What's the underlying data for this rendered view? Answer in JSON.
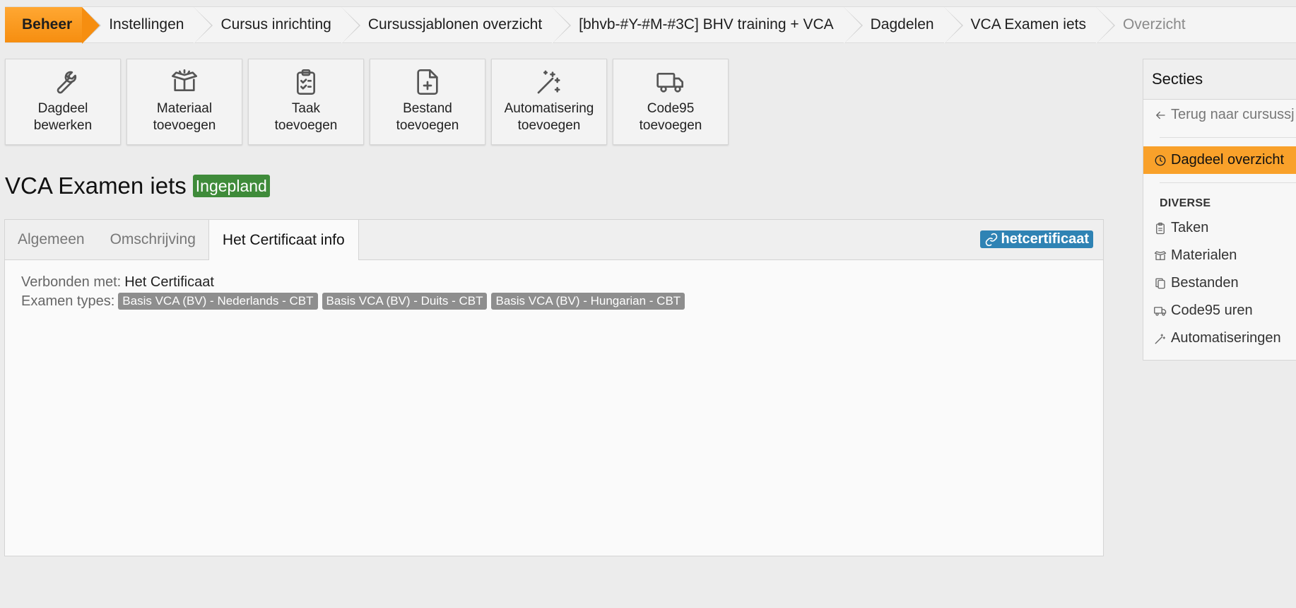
{
  "breadcrumb": [
    {
      "label": "Beheer"
    },
    {
      "label": "Instellingen"
    },
    {
      "label": "Cursus inrichting"
    },
    {
      "label": "Cursussjablonen overzicht"
    },
    {
      "label": "[bhvb-#Y-#M-#3C] BHV training + VCA"
    },
    {
      "label": "Dagdelen"
    },
    {
      "label": "VCA Examen iets"
    },
    {
      "label": "Overzicht"
    }
  ],
  "actions": [
    {
      "label": "Dagdeel\nbewerken",
      "icon": "wrench-icon"
    },
    {
      "label": "Materiaal\ntoevoegen",
      "icon": "box-icon"
    },
    {
      "label": "Taak\ntoevoegen",
      "icon": "clipboard-icon"
    },
    {
      "label": "Bestand\ntoevoegen",
      "icon": "file-plus-icon"
    },
    {
      "label": "Automatisering\ntoevoegen",
      "icon": "magic-wand-icon"
    },
    {
      "label": "Code95\ntoevoegen",
      "icon": "truck-icon"
    }
  ],
  "page": {
    "title": "VCA Examen iets",
    "status": "Ingepland",
    "status_color": "#3f8b3a"
  },
  "tabs": [
    {
      "label": "Algemeen"
    },
    {
      "label": "Omschrijving"
    },
    {
      "label": "Het Certificaat info",
      "active": true
    }
  ],
  "tab_tag": {
    "label": "hetcertificaat",
    "color": "#2f83b4",
    "icon": "link-icon"
  },
  "info": {
    "connected_label": "Verbonden met:",
    "connected_value": "Het Certificaat",
    "exam_types_label": "Examen types:",
    "exam_types": [
      "Basis VCA (BV) - Nederlands - CBT",
      "Basis VCA (BV) - Duits - CBT",
      "Basis VCA (BV) - Hungarian - CBT"
    ]
  },
  "sidebar": {
    "title": "Secties",
    "back_label": "Terug naar cursussj",
    "active_label": "Dagdeel overzicht",
    "group_label": "DIVERSE",
    "items": [
      {
        "label": "Taken",
        "icon": "clipboard-icon"
      },
      {
        "label": "Materialen",
        "icon": "box-icon"
      },
      {
        "label": "Bestanden",
        "icon": "copy-icon"
      },
      {
        "label": "Code95 uren",
        "icon": "truck-icon"
      },
      {
        "label": "Automatiseringen",
        "icon": "magic-wand-icon"
      }
    ]
  },
  "colors": {
    "accent": "#f68e10",
    "sidebar_active": "#f9a12a",
    "chip": "#8e8e8e"
  }
}
